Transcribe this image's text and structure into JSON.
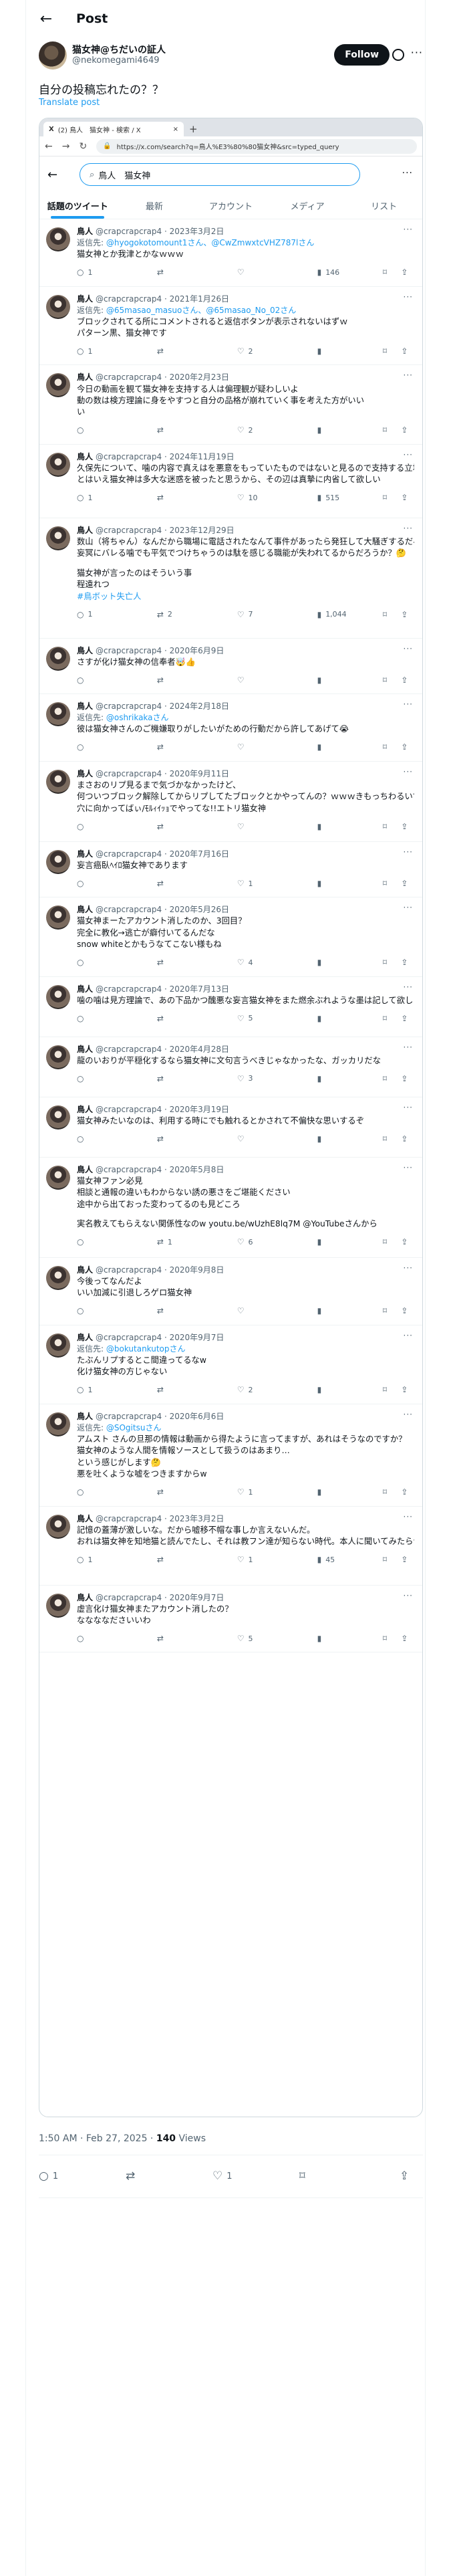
{
  "header": {
    "title": "Post"
  },
  "author": {
    "name": "猫女神@ちだいの証人",
    "handle": "@nekomegami4649",
    "follow_label": "Follow",
    "more": "···"
  },
  "post": {
    "text": "自分の投稿忘れたの？？",
    "translate": "Translate post",
    "timestamp": "1:50 AM · Feb 27, 2025 · ",
    "views_num": "140",
    "views_word": " Views"
  },
  "post_actions": {
    "replies": "1",
    "reposts": "",
    "likes": "1"
  },
  "browser": {
    "tab_label": "(2) 鳥人　猫女神 - 検索 / X",
    "tab_icon": "X",
    "new_tab": "+",
    "url": "https://x.com/search?q=鳥人%E3%80%80猫女神&src=typed_query"
  },
  "search": {
    "query": "鳥人　猫女神",
    "more": "···"
  },
  "tabs": [
    "話題のツイート",
    "最新",
    "アカウント",
    "メディア",
    "リスト"
  ],
  "tweets": [
    {
      "name": "鳥人",
      "meta": "@crapcrapcrap4 · 2023年3月2日",
      "reply": "返信先: ",
      "mentions": "@hyogokotomount1さん、@CwZmwxtcVHZ787lさん",
      "lines": [
        "猫女神とか我津とかなｗｗｗ"
      ],
      "links": [],
      "r": "1",
      "rt": "",
      "l": "",
      "v": "146"
    },
    {
      "name": "鳥人",
      "meta": "@crapcrapcrap4 · 2021年1月26日",
      "reply": "返信先: ",
      "mentions": "@65masao_masuoさん、@65masao_No_02さん",
      "lines": [
        "ブロックされてる所にコメントされると返信ボタンが表示されないはずｗ",
        "パターン黒、猫女神です"
      ],
      "links": [],
      "r": "1",
      "rt": "",
      "l": "2",
      "v": ""
    },
    {
      "name": "鳥人",
      "meta": "@crapcrapcrap4 · 2020年2月23日",
      "reply": "",
      "mentions": "",
      "lines": [
        "今日の動画を観て猫女神を支持する人は偏理観が疑わしいよ",
        "動の数は検方理論に身をやすつと自分の品格が崩れていく事を考えた方がいい",
        "い"
      ],
      "links": [],
      "r": "",
      "rt": "",
      "l": "2",
      "v": ""
    },
    {
      "name": "鳥人",
      "meta": "@crapcrapcrap4 · 2024年11月19日",
      "reply": "",
      "mentions": "",
      "lines": [
        "久保先について、噛の内容で真えはを悪意をもっていたものではないと見るので支持する立場は変わらないな。",
        "とはいえ猫女神は多大な迷惑を被ったと思うから、その辺は真摯に内省して欲しい"
      ],
      "links": [],
      "r": "1",
      "rt": "",
      "l": "10",
      "v": "515"
    },
    {
      "name": "鳥人",
      "meta": "@crapcrapcrap4 · 2023年12月29日",
      "reply": "",
      "mentions": "",
      "lines": [
        "数山（将ちゃん）なんだから職場に電話されたなんて事件があったら発狂して大騒ぎするだろ😅😅😅",
        "妄冥にバレる噛でも平気でつけちゃうのは駄を感じる職能が失われてるからだろうか？🤔",
        "",
        "猫女神が言ったのはそういう事",
        "程遠れつ",
        "#鳥ボット失亡人"
      ],
      "links": [
        5
      ],
      "r": "1",
      "rt": "2",
      "l": "7",
      "v": "1,044"
    },
    {
      "name": "鳥人",
      "meta": "@crapcrapcrap4 · 2020年6月9日",
      "reply": "",
      "mentions": "",
      "lines": [
        "さすが化け猫女神の信奉者🤯👍"
      ],
      "links": [],
      "r": "",
      "rt": "",
      "l": "",
      "v": ""
    },
    {
      "name": "鳥人",
      "meta": "@crapcrapcrap4 · 2024年2月18日",
      "reply": "返信先: ",
      "mentions": "@oshrikakaさん",
      "lines": [
        "彼は猫女神さんのご機嫌取りがしたいがための行動だから許してあげて😭"
      ],
      "links": [],
      "r": "",
      "rt": "",
      "l": "",
      "v": ""
    },
    {
      "name": "鳥人",
      "meta": "@crapcrapcrap4 · 2020年9月11日",
      "reply": "",
      "mentions": "",
      "lines": [
        "まさおのリプ見るまで気づかなかったけど、",
        "何ついつブロック解除してからリプしてたブロックとかやってんの？ｗｗｗきもっちわるいですぅぅぅ、「青い」って貴重がこれほどしっくりくる人間は初めてだよ。",
        "穴に向かってばぃ/ﾓﾙｨｲｯｮでやってな!!エトリ猫女神"
      ],
      "links": [],
      "r": "",
      "rt": "",
      "l": "",
      "v": ""
    },
    {
      "name": "鳥人",
      "meta": "@crapcrapcrap4 · 2020年7月16日",
      "reply": "",
      "mentions": "",
      "lines": [
        "妄言癌臥ﾍｲﾛ猫女神であります"
      ],
      "links": [],
      "r": "",
      "rt": "",
      "l": "1",
      "v": ""
    },
    {
      "name": "鳥人",
      "meta": "@crapcrapcrap4 · 2020年5月26日",
      "reply": "",
      "mentions": "",
      "lines": [
        "猫女神まーたアカウント消したのか、3回目？",
        "完全に教化→逃亡が癖付いてるんだな",
        "snow whiteとかもうなてこない様もね"
      ],
      "links": [],
      "r": "",
      "rt": "",
      "l": "4",
      "v": ""
    },
    {
      "name": "鳥人",
      "meta": "@crapcrapcrap4 · 2020年7月13日",
      "reply": "",
      "mentions": "",
      "lines": [
        "噛の噛は見方理論で、あの下品かつ醜悪な妄言猫女神をまた燃余ぶれような墨は記して欲しくないなあ"
      ],
      "links": [],
      "r": "",
      "rt": "",
      "l": "5",
      "v": ""
    },
    {
      "name": "鳥人",
      "meta": "@crapcrapcrap4 · 2020年4月28日",
      "reply": "",
      "mentions": "",
      "lines": [
        "龍のいおりが平穏化するなら猫女神に文句言うべきじゃなかったな、ガッカリだな"
      ],
      "links": [],
      "r": "",
      "rt": "",
      "l": "3",
      "v": ""
    },
    {
      "name": "鳥人",
      "meta": "@crapcrapcrap4 · 2020年3月19日",
      "reply": "",
      "mentions": "",
      "lines": [
        "猫女神みたいなのは、利用する時にでも触れるとかされて不偏快な思いするぞ"
      ],
      "links": [],
      "r": "",
      "rt": "",
      "l": "",
      "v": ""
    },
    {
      "name": "鳥人",
      "meta": "@crapcrapcrap4 · 2020年5月8日",
      "reply": "",
      "mentions": "",
      "lines": [
        "猫女神ファン必見",
        "相談と通報の違いもわからない誘の悪さをご堪能ください",
        "途中から出ておった変わってるのも見どころ",
        "",
        "実名教えてもらえない関係性なのw youtu.be/wUzhE8lq7M @YouTubeさんから"
      ],
      "links": [],
      "r": "",
      "rt": "1",
      "l": "6",
      "v": ""
    },
    {
      "name": "鳥人",
      "meta": "@crapcrapcrap4 · 2020年9月8日",
      "reply": "",
      "mentions": "",
      "lines": [
        "今後ってなんだよ",
        "いい加減に引退しろゲロ猫女神"
      ],
      "links": [],
      "r": "",
      "rt": "",
      "l": "",
      "v": ""
    },
    {
      "name": "鳥人",
      "meta": "@crapcrapcrap4 · 2020年9月7日",
      "reply": "返信先: ",
      "mentions": "@bokutankutopさん",
      "lines": [
        "たぶんリプするとこ間違ってるなw",
        "化け猫女神の方じゃない"
      ],
      "links": [],
      "r": "1",
      "rt": "",
      "l": "2",
      "v": ""
    },
    {
      "name": "鳥人",
      "meta": "@crapcrapcrap4 · 2020年6月6日",
      "reply": "返信先: ",
      "mentions": "@SOgitsuさん",
      "lines": [
        "アムスト さんの旦那の情報は動画から得たように言ってますが、あれはそうなのですか？",
        "猫女神のような人間を情報ソースとして扱うのはあまり…",
        "という感じがします🤔",
        "悪を吐くような嘘をつきますからw"
      ],
      "links": [],
      "r": "",
      "rt": "",
      "l": "1",
      "v": ""
    },
    {
      "name": "鳥人",
      "meta": "@crapcrapcrap4 · 2023年3月2日",
      "reply": "",
      "mentions": "",
      "lines": [
        "記憶の蓋薄が激しいな。だから嘘移不帽な事しか言えないんだ。",
        "おれは猫女神を知地猫と読んでたし、それは教フン達が知らない時代。本人に聞いてみたらｗｗ"
      ],
      "links": [],
      "r": "1",
      "rt": "",
      "l": "1",
      "v": "45"
    },
    {
      "name": "鳥人",
      "meta": "@crapcrapcrap4 · 2020年9月7日",
      "reply": "",
      "mentions": "",
      "lines": [
        "虚言化け猫女神またアカウント消したの？",
        "ななななださいいわ"
      ],
      "links": [],
      "r": "",
      "rt": "",
      "l": "5",
      "v": ""
    }
  ]
}
